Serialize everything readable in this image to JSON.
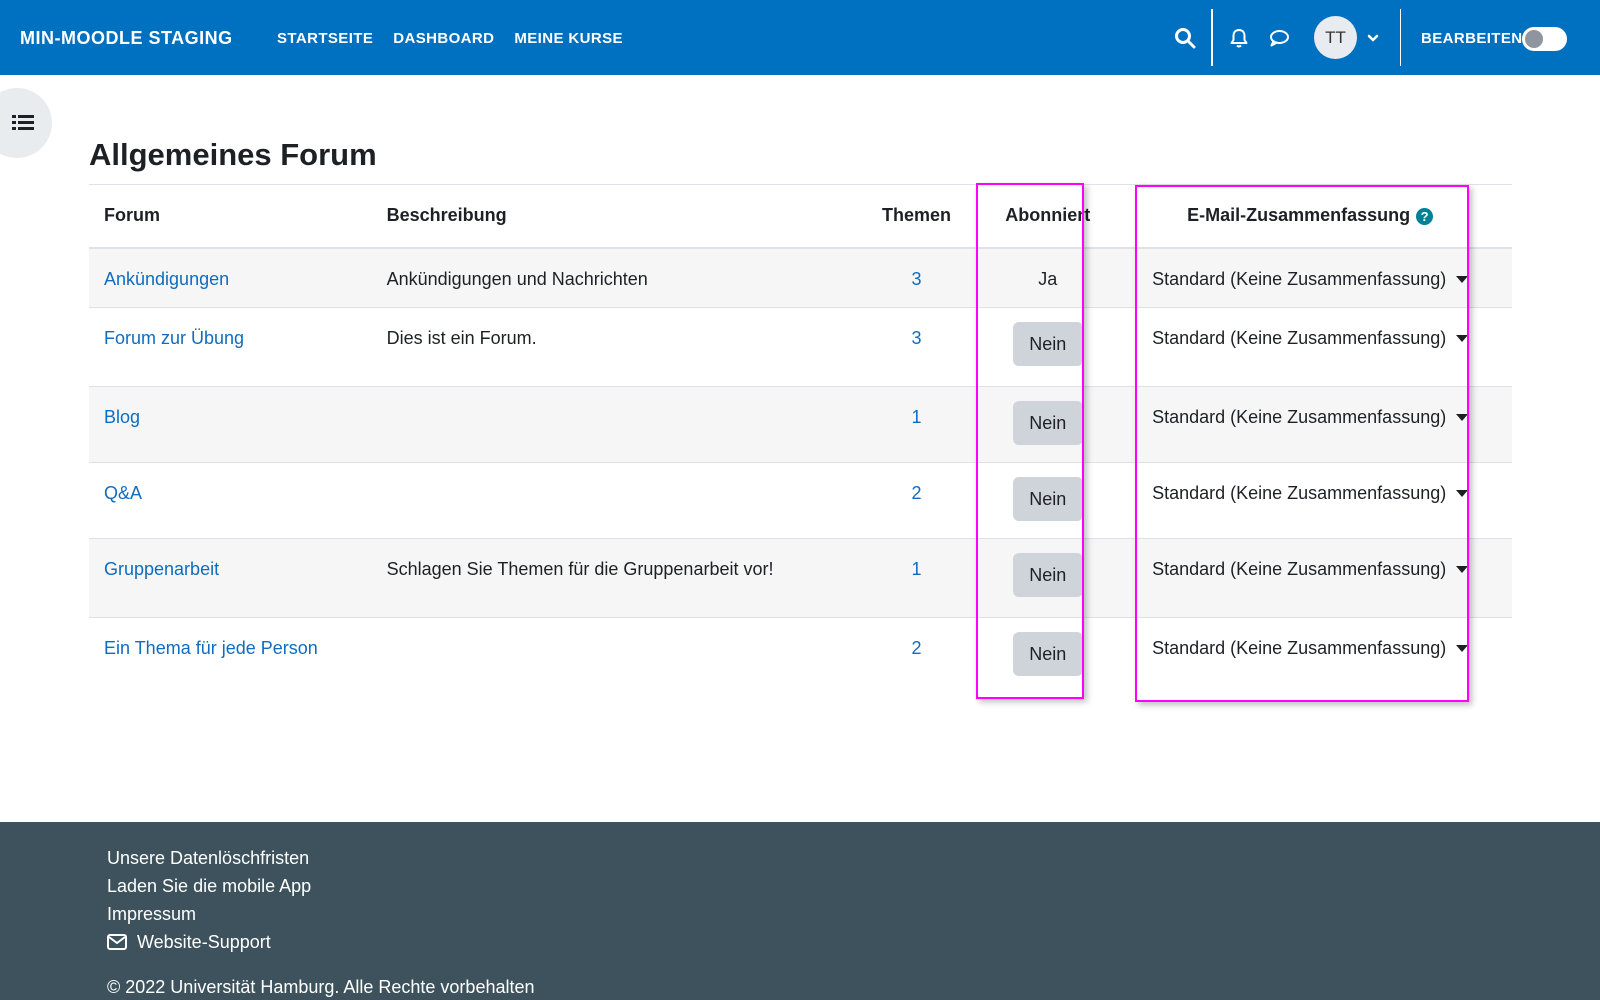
{
  "navbar": {
    "brand": "MIN-MOODLE STAGING",
    "links": [
      "STARTSEITE",
      "DASHBOARD",
      "MEINE KURSE"
    ],
    "avatar_initials": "TT",
    "edit_label": "BEARBEITEN"
  },
  "page": {
    "title": "Allgemeines Forum"
  },
  "table": {
    "headers": {
      "forum": "Forum",
      "description": "Beschreibung",
      "topics": "Themen",
      "subscribed": "Abonniert",
      "digest": "E-Mail-Zusammenfassung"
    },
    "rows": [
      {
        "forum": "Ankündigungen",
        "description": "Ankündigungen und Nachrichten",
        "topics": "3",
        "subscribed": "Ja",
        "subscribed_is_button": false,
        "digest": "Standard (Keine Zusammenfassung)"
      },
      {
        "forum": "Forum zur Übung",
        "description": "Dies ist ein Forum.",
        "topics": "3",
        "subscribed": "Nein",
        "subscribed_is_button": true,
        "digest": "Standard (Keine Zusammenfassung)"
      },
      {
        "forum": "Blog",
        "description": "",
        "topics": "1",
        "subscribed": "Nein",
        "subscribed_is_button": true,
        "digest": "Standard (Keine Zusammenfassung)"
      },
      {
        "forum": "Q&A",
        "description": "",
        "topics": "2",
        "subscribed": "Nein",
        "subscribed_is_button": true,
        "digest": "Standard (Keine Zusammenfassung)"
      },
      {
        "forum": "Gruppenarbeit",
        "description": "Schlagen Sie Themen für die Gruppenarbeit vor!",
        "topics": "1",
        "subscribed": "Nein",
        "subscribed_is_button": true,
        "digest": "Standard (Keine Zusammenfassung)"
      },
      {
        "forum": "Ein Thema für jede Person",
        "description": "",
        "topics": "2",
        "subscribed": "Nein",
        "subscribed_is_button": true,
        "digest": "Standard (Keine Zusammenfassung)"
      }
    ]
  },
  "footer": {
    "links": [
      "Unsere Datenlöschfristen",
      "Laden Sie die mobile App",
      "Impressum"
    ],
    "support": "Website-Support",
    "copyright": "© 2022 Universität Hamburg. Alle Rechte vorbehalten"
  },
  "colors": {
    "navbar": "#0070c0",
    "link": "#0f6cbf",
    "footer": "#3d525c",
    "highlight": "#ff00ff"
  }
}
